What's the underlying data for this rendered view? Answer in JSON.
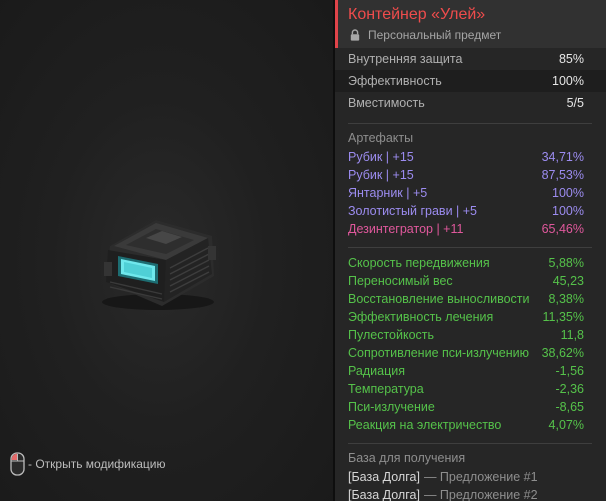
{
  "hint": {
    "text": "- Открыть модификацию",
    "icon": "mouse-icon"
  },
  "item": {
    "title": "Контейнер «Улей»",
    "subtitle": "Персональный предмет",
    "subtitle_icon": "lock-icon",
    "accent_color": "#ef4c4c"
  },
  "stats": [
    {
      "label": "Внутренняя защита",
      "value": "85%"
    },
    {
      "label": "Эффективность",
      "value": "100%"
    },
    {
      "label": "Вместимость",
      "value": "5/5"
    }
  ],
  "artifacts": {
    "title": "Артефакты",
    "items": [
      {
        "label": "Рубик | +15",
        "value": "34,71%"
      },
      {
        "label": "Рубик | +15",
        "value": "87,53%"
      },
      {
        "label": "Янтарник | +5",
        "value": "100%"
      },
      {
        "label": "Золотистый грави | +5",
        "value": "100%"
      },
      {
        "label": "Дезинтегратор | +11",
        "value": "65,46%"
      }
    ],
    "color": "#9c8cf0",
    "highlight_color": "#e0589c"
  },
  "effects": {
    "color": "#55c24a",
    "items": [
      {
        "label": "Скорость передвижения",
        "value": "5,88%"
      },
      {
        "label": "Переносимый вес",
        "value": "45,23"
      },
      {
        "label": "Восстановление выносливости",
        "value": "8,38%"
      },
      {
        "label": "Эффективность лечения",
        "value": "11,35%"
      },
      {
        "label": "Пулестойкость",
        "value": "11,8"
      },
      {
        "label": "Сопротивление пси-излучению",
        "value": "38,62%"
      },
      {
        "label": "Радиация",
        "value": "-1,56"
      },
      {
        "label": "Температура",
        "value": "-2,36"
      },
      {
        "label": "Пси-излучение",
        "value": "-8,65"
      },
      {
        "label": "Реакция на электричество",
        "value": "4,07%"
      }
    ]
  },
  "base": {
    "title": "База для получения",
    "items": [
      {
        "name": "[База Долга]",
        "offer": "— Предложение #1"
      },
      {
        "name": "[База Долга]",
        "offer": "— Предложение #2"
      }
    ]
  }
}
